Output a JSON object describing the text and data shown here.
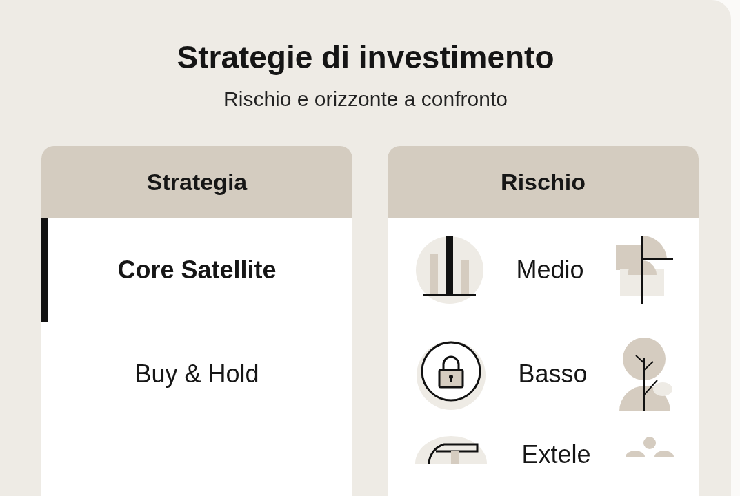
{
  "title": "Strategie di investimento",
  "subtitle": "Rischio e orizzonte a confronto",
  "strategy_column": {
    "heading": "Strategia",
    "rows": [
      {
        "label": "Core Satellite",
        "selected": true
      },
      {
        "label": "Buy & Hold",
        "selected": false
      }
    ]
  },
  "risk_column": {
    "heading": "Rischio",
    "rows": [
      {
        "label": "Medio",
        "kind": "bars"
      },
      {
        "label": "Basso",
        "kind": "lock"
      },
      {
        "label": "Extele",
        "kind": "arch"
      }
    ]
  }
}
